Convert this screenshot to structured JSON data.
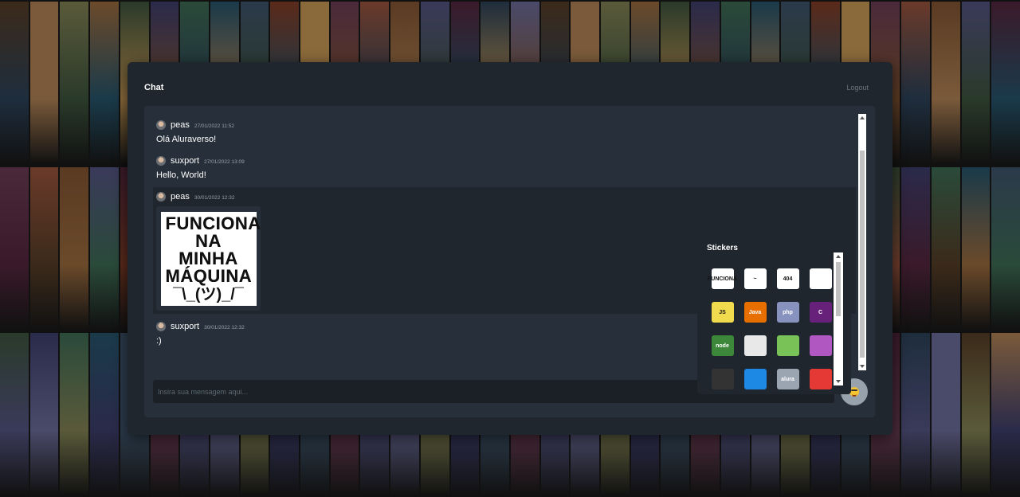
{
  "app": {
    "title": "Chat",
    "logout_label": "Logout"
  },
  "messages": [
    {
      "user": "peas",
      "date": "27/01/2022 11:52",
      "text": "Olá Aluraverso!",
      "type": "text"
    },
    {
      "user": "suxport",
      "date": "27/01/2022 13:09",
      "text": "Hello, World!",
      "type": "text"
    },
    {
      "user": "peas",
      "date": "30/01/2022 12:32",
      "type": "sticker",
      "sticker_lines": [
        "FUNCIONA",
        "NA MINHA",
        "MÁQUINA",
        "¯\\_(ツ)_/¯"
      ]
    },
    {
      "user": "suxport",
      "date": "30/01/2022 12:32",
      "text": ":)",
      "type": "text"
    }
  ],
  "input": {
    "placeholder": "Insira sua mensagem aqui..."
  },
  "stickers_panel": {
    "title": "Stickers",
    "items": [
      {
        "name": "funciona-na-minha-maquina",
        "label": "FUNCIONA",
        "color": "#ffffff"
      },
      {
        "name": "octocat-sticker",
        "label": "~",
        "color": "#ffffff"
      },
      {
        "name": "error-404",
        "label": "404",
        "color": "#ffffff"
      },
      {
        "name": "browser-window",
        "label": "",
        "color": "#ffffff"
      },
      {
        "name": "javascript",
        "label": "JS",
        "color": "#f0db4f"
      },
      {
        "name": "java",
        "label": "Java",
        "color": "#e76f00"
      },
      {
        "name": "php",
        "label": "php",
        "color": "#8892bf"
      },
      {
        "name": "csharp",
        "label": "C",
        "color": "#68217a"
      },
      {
        "name": "nodejs",
        "label": "node",
        "color": "#3c873a"
      },
      {
        "name": "ghost-white",
        "label": "",
        "color": "#e8e8e8"
      },
      {
        "name": "android-badge",
        "label": "",
        "color": "#78c257"
      },
      {
        "name": "purple-badge",
        "label": "",
        "color": "#b057c2"
      },
      {
        "name": "octocat-dark",
        "label": "",
        "color": "#333333"
      },
      {
        "name": "blue-robot",
        "label": "",
        "color": "#1e88e5"
      },
      {
        "name": "alura",
        "label": "alura",
        "color": "#9aa5b1"
      },
      {
        "name": "red-banner",
        "label": "",
        "color": "#e53935"
      }
    ]
  },
  "colors": {
    "app_bg": "#1f262d",
    "panel_bg": "#27303a",
    "highlight_row": "#1f262d"
  }
}
